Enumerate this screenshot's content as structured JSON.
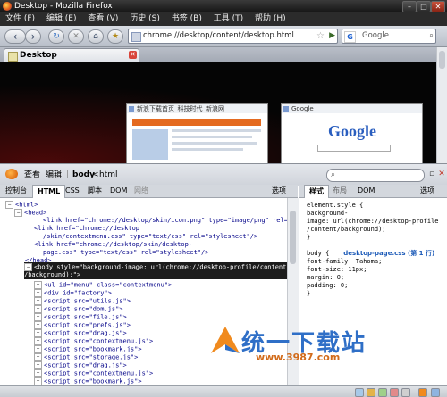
{
  "window": {
    "title": "Desktop - Mozilla Firefox",
    "btn_min": "–",
    "btn_max": "□",
    "btn_close": "✕"
  },
  "menubar": [
    "文件 (F)",
    "编辑 (E)",
    "查看 (V)",
    "历史 (S)",
    "书签 (B)",
    "工具 (T)",
    "帮助 (H)"
  ],
  "nav": {
    "back": "‹",
    "forward": "›",
    "reload": "↻",
    "stop": "✕",
    "home": "⌂",
    "url": "chrome://desktop/content/desktop.html",
    "star": "☆",
    "go": "▶",
    "search_engine": "G",
    "search_placeholder": "Google",
    "search_icon": "⌕"
  },
  "tabs": [
    {
      "label": "Desktop",
      "close": "✕"
    }
  ],
  "thumbnails": [
    {
      "title": "新浪下载首页_科技时代_新浪网"
    },
    {
      "title": "Google",
      "logo": "Google"
    }
  ],
  "devtools": {
    "menu_view": "查看",
    "menu_edit": "编辑",
    "breadcrumb_body": "body",
    "breadcrumb_sep": "<",
    "breadcrumb_html": "html",
    "search_icon": "⌕",
    "panel_tabs": [
      "控制台",
      "HTML",
      "CSS",
      "脚本",
      "DOM",
      "网络"
    ],
    "panel_active": "HTML",
    "panel_options": "选项",
    "side_tabs": [
      "样式",
      "布局",
      "DOM"
    ],
    "side_active": "样式",
    "side_options": "选项"
  },
  "html_lines": [
    {
      "twisty": "−",
      "text": "<html>"
    },
    {
      "twisty": "−",
      "text": "<head>"
    },
    {
      "twisty": "",
      "text": "<link href=\"chrome://desktop/skin/icon.png\" type=\"image/png\" rel=\"icon\"/>"
    },
    {
      "twisty": "",
      "text": "<link href=\"chrome://desktop"
    },
    {
      "twisty": "",
      "text": "/skin/contextmenu.css\" type=\"text/css\" rel=\"stylesheet\"/>"
    },
    {
      "twisty": "",
      "text": "<link href=\"chrome://desktop/skin/desktop-"
    },
    {
      "twisty": "",
      "text": "page.css\" type=\"text/css\" rel=\"stylesheet\"/>"
    },
    {
      "twisty": "",
      "text": "</head>"
    },
    {
      "twisty": "−",
      "text": "<body style=\"background-image: url(chrome://desktop-profile/content"
    },
    {
      "twisty": "",
      "text": "/background);\">"
    },
    {
      "twisty": "+",
      "text": "<ul id=\"menu\" class=\"contextmenu\">"
    },
    {
      "twisty": "+",
      "text": "<div id=\"factory\">"
    },
    {
      "twisty": "+",
      "text": "<script src=\"utils.js\">"
    },
    {
      "twisty": "+",
      "text": "<script src=\"dom.js\">"
    },
    {
      "twisty": "+",
      "text": "<script src=\"file.js\">"
    },
    {
      "twisty": "+",
      "text": "<script src=\"prefs.js\">"
    },
    {
      "twisty": "+",
      "text": "<script src=\"drag.js\">"
    },
    {
      "twisty": "+",
      "text": "<script src=\"contextmenu.js\">"
    },
    {
      "twisty": "+",
      "text": "<script src=\"bookmark.js\">"
    },
    {
      "twisty": "+",
      "text": "<script src=\"storage.js\">"
    },
    {
      "twisty": "+",
      "text": "<script src=\"drag.js\">"
    },
    {
      "twisty": "+",
      "text": "<script src=\"contextmenu.js\">"
    },
    {
      "twisty": "+",
      "text": "<script src=\"bookmark.js\">"
    }
  ],
  "style_lines": [
    {
      "text": "element.style {",
      "src": ""
    },
    {
      "text": "    background-",
      "src": ""
    },
    {
      "text": "    image: url(chrome://desktop-profile",
      "src": ""
    },
    {
      "text": "    /content/background);",
      "src": ""
    },
    {
      "text": "}",
      "src": ""
    },
    {
      "text": "",
      "src": ""
    },
    {
      "text": "body {",
      "src": "desktop-page.css (第 1 行)"
    },
    {
      "text": "    font-family: Tahoma;",
      "src": ""
    },
    {
      "text": "    font-size: 11px;",
      "src": ""
    },
    {
      "text": "    margin: 0;",
      "src": ""
    },
    {
      "text": "    padding: 0;",
      "src": ""
    },
    {
      "text": "}",
      "src": ""
    }
  ],
  "watermark": {
    "brand": "统一下载站",
    "url": "www.3987.com"
  },
  "colors": {
    "selection": "#1c1c1c",
    "accent": "#2f6fc7"
  }
}
